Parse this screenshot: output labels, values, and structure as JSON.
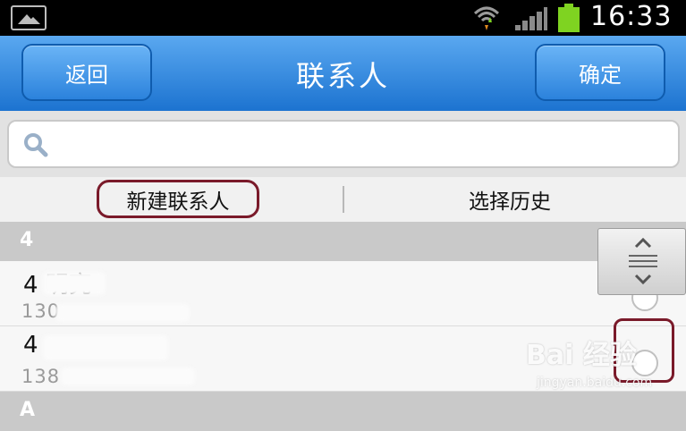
{
  "status_bar": {
    "time": "16:33",
    "icons": [
      "gallery-notification-icon",
      "wifi-icon",
      "signal-icon",
      "battery-icon"
    ],
    "battery_color": "#7fd321"
  },
  "header": {
    "title": "联系人",
    "back_label": "返回",
    "confirm_label": "确定",
    "bg_color": "#1c73d0"
  },
  "search": {
    "placeholder": "",
    "value": ""
  },
  "tabs": [
    {
      "label": "新建联系人",
      "highlighted": true
    },
    {
      "label": "选择历史",
      "highlighted": false
    }
  ],
  "sections": [
    {
      "letter": "4",
      "contacts": [
        {
          "name": "4   明亮",
          "phone": "130"
        },
        {
          "name": "4",
          "phone": "138"
        }
      ]
    },
    {
      "letter": "A",
      "contacts": []
    }
  ],
  "watermark": {
    "text": "Bai 经验",
    "sub": "jingyan.baidu.com"
  }
}
